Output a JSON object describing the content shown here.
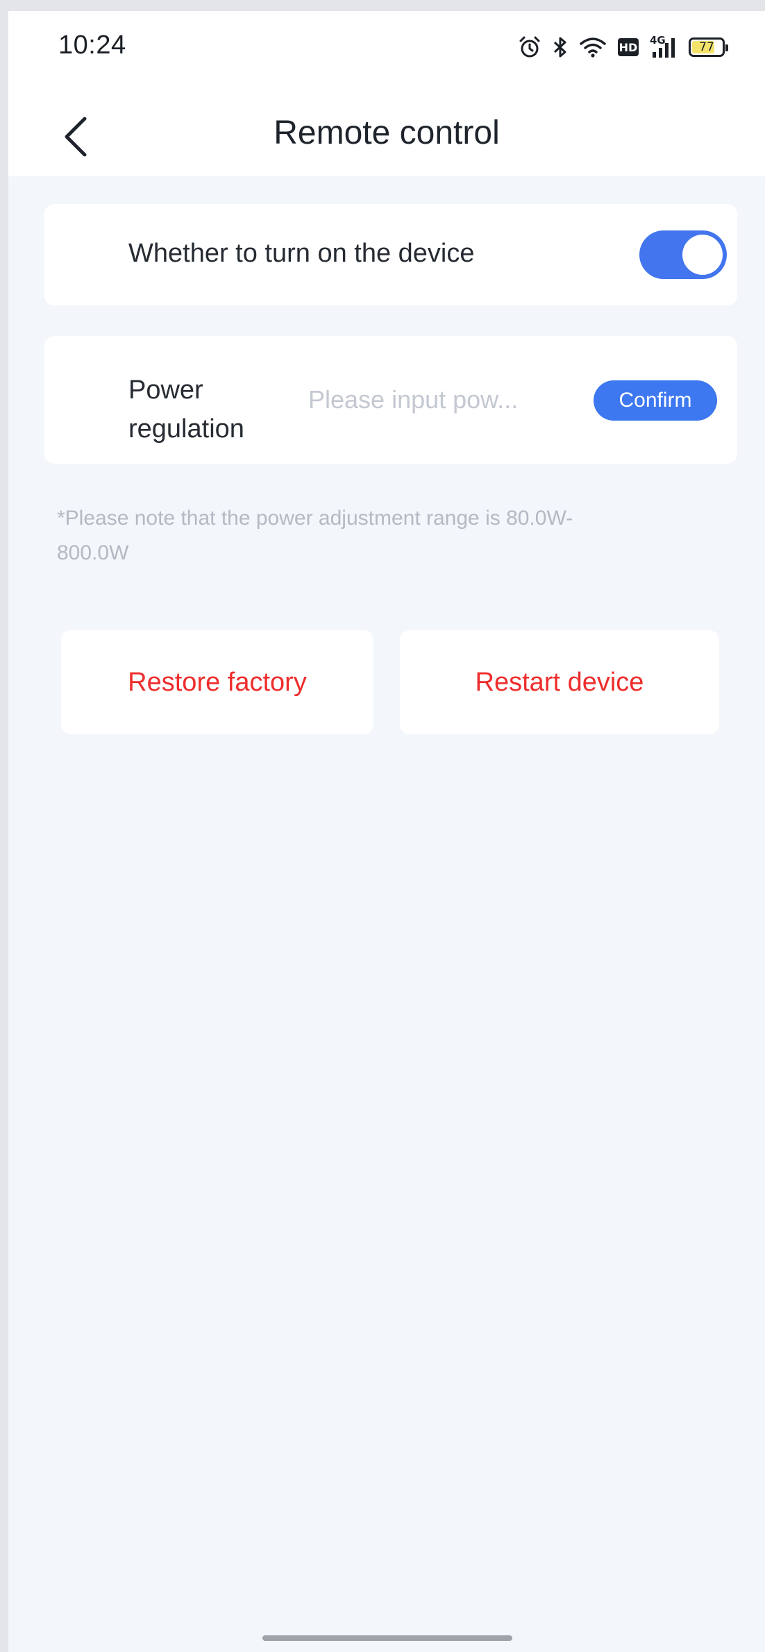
{
  "status_bar": {
    "time": "10:24",
    "icons": [
      "alarm-icon",
      "bluetooth-icon",
      "wifi-icon",
      "hd-icon",
      "signal-4g-icon",
      "battery-icon"
    ],
    "hd_label": "HD",
    "network_label": "4G",
    "battery_level": "77"
  },
  "header": {
    "back_icon": "chevron-left-icon",
    "title": "Remote control"
  },
  "device_toggle": {
    "label": "Whether to turn on the device",
    "on": true,
    "accent_color": "#4275ee"
  },
  "power_regulation": {
    "label": "Power regulation",
    "input_value": "",
    "placeholder": "Please input pow...",
    "confirm_label": "Confirm"
  },
  "note": "*Please note that the power adjustment range is 80.0W-800.0W",
  "actions": {
    "restore_label": "Restore factory",
    "restart_label": "Restart device",
    "danger_color": "#ee2d2d"
  }
}
